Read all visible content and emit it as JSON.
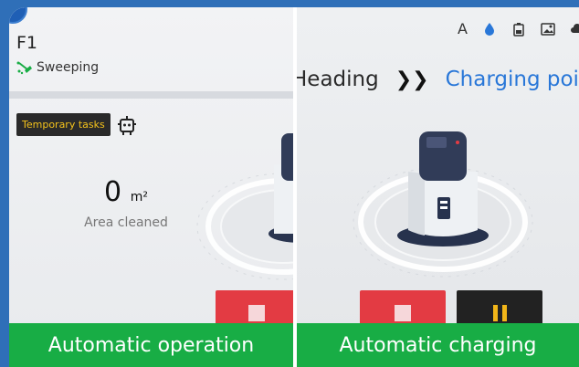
{
  "left_panel": {
    "floor": "F1",
    "mode_label": "Sweeping",
    "temp_tasks_label": "Temporary tasks",
    "area_value": "0",
    "area_unit": "m²",
    "area_label": "Area cleaned",
    "bottom_status": "Automatic operation"
  },
  "right_panel": {
    "route_from": "Heading",
    "route_to": "Charging point",
    "status_letter": "A",
    "bottom_status": "Automatic  charging"
  },
  "colors": {
    "frame_blue": "#2f6fb8",
    "status_green": "#18ad45",
    "stop_red": "#e33b43",
    "pause_dark": "#222222",
    "pause_yellow": "#f2b619",
    "accent_blue": "#2977d8",
    "temp_text": "#f4c21b"
  },
  "icons": [
    "sweep-icon",
    "robot-icon",
    "stop-icon",
    "water-drop-icon",
    "battery-icon",
    "image-icon",
    "cloud-icon",
    "pause-icon"
  ]
}
